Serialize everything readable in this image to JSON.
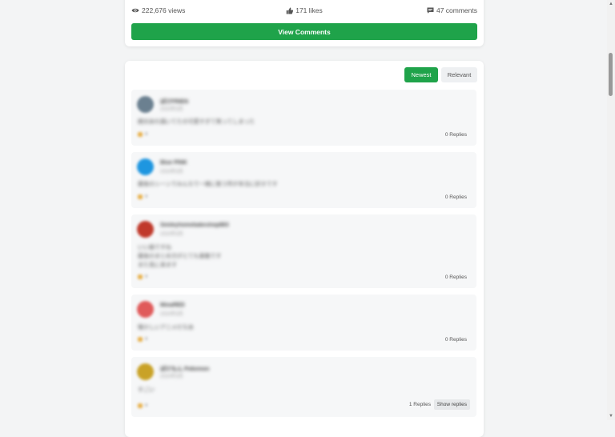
{
  "post": {
    "views": "222,676 views",
    "likes": "171 likes",
    "comments": "47 comments",
    "view_comments_label": "View Comments"
  },
  "sort": {
    "newest_label": "Newest",
    "relevant_label": "Relevant"
  },
  "comments": [
    {
      "author": "ぽけFRIEN",
      "date": "2024年3月",
      "body_lines": [
        "絶対あれ描いてたの可愛すぎて笑ってしまった"
      ],
      "like_count": "0",
      "replies": "0 Replies",
      "avatar_color": "#6b8090"
    },
    {
      "author": "Blue PINK",
      "date": "2024年3月",
      "body_lines": [
        "最後のシーンでみんなで一緒に歌う所が本当に好きです"
      ],
      "like_count": "0",
      "replies": "0 Replies",
      "avatar_color": "#1e96e0"
    },
    {
      "author": "Smileyhomebakeshop883",
      "date": "2024年3月",
      "body_lines": [
        "いい曲ですね",
        "最後のまとめ方がとても素敵です",
        "また見に来ます"
      ],
      "like_count": "0",
      "replies": "0 Replies",
      "avatar_color": "#c0392b"
    },
    {
      "author": "MinaRED",
      "date": "2024年3月",
      "body_lines": [
        "懐かしいアニメだなあ"
      ],
      "like_count": "0",
      "replies": "0 Replies",
      "avatar_color": "#e05a5a"
    },
    {
      "author": "ぽけもん Pokemon",
      "date": "2024年3月",
      "body_lines": [
        "すごい"
      ],
      "like_count": "0",
      "replies": "1 Replies",
      "show_replies_label": "Show replies",
      "avatar_color": "#c9a227"
    }
  ],
  "colors": {
    "accent": "#1fa34a",
    "background": "#f3f4f5"
  },
  "icons": {
    "views": "eye-icon",
    "likes": "thumbs-up-icon",
    "comments": "comment-icon"
  }
}
